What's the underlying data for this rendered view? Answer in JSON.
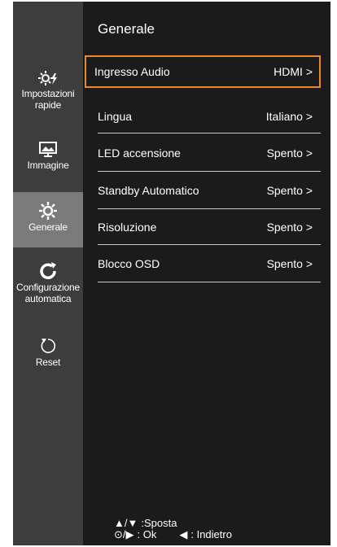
{
  "sidebar": {
    "items": [
      {
        "label": "Impostazioni\nrapide",
        "icon": "quick-settings-icon",
        "active": false
      },
      {
        "label": "Immagine",
        "icon": "picture-icon",
        "active": false
      },
      {
        "label": "Generale",
        "icon": "gear-icon",
        "active": true
      },
      {
        "label": "Configurazione\nautomatica",
        "icon": "auto-config-icon",
        "active": false
      },
      {
        "label": "Reset",
        "icon": "reset-icon",
        "active": false
      }
    ]
  },
  "main": {
    "title": "Generale",
    "rows": [
      {
        "label": "Ingresso Audio",
        "value": "HDMI >",
        "selected": true
      },
      {
        "label": "Lingua",
        "value": "Italiano >",
        "selected": false
      },
      {
        "label": "LED accensione",
        "value": "Spento >",
        "selected": false
      },
      {
        "label": "Standby Automatico",
        "value": "Spento >",
        "selected": false
      },
      {
        "label": "Risoluzione",
        "value": "Spento >",
        "selected": false
      },
      {
        "label": "Blocco OSD",
        "value": "Spento >",
        "selected": false
      }
    ]
  },
  "footer": {
    "move_keys": "▲/▼",
    "move_label": ":Sposta",
    "ok_keys": "⊙/▶",
    "ok_label": ": Ok",
    "back_keys": "◀",
    "back_label": ": Indietro"
  },
  "colors": {
    "background": "#1b1b1b",
    "sidebar": "#3d3d3d",
    "sidebar_active": "#7a7a7a",
    "selection_border": "#e98a32",
    "text": "#ffffff"
  }
}
